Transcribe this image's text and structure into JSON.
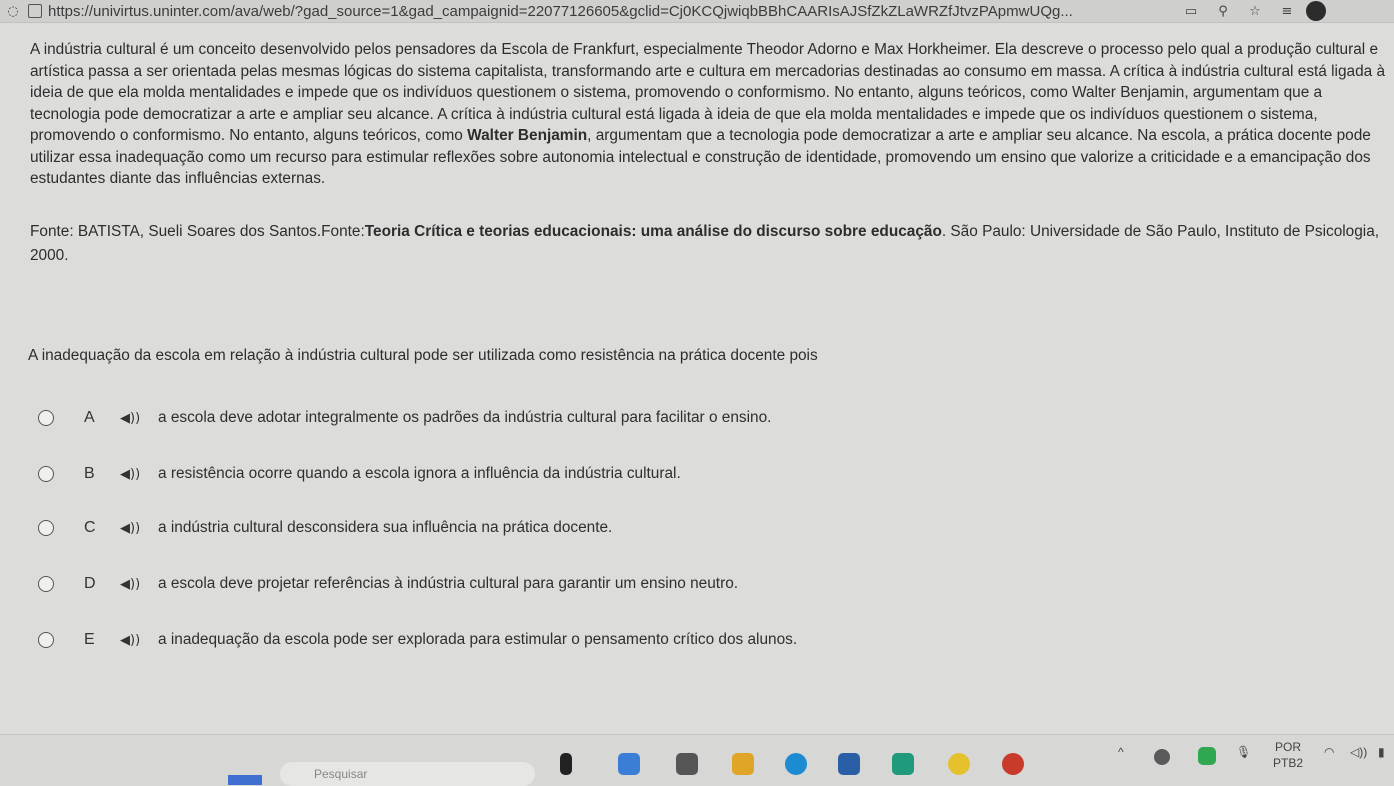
{
  "browser": {
    "url": "https://univirtus.uninter.com/ava/web/?gad_source=1&gad_campaignid=22077126605&gclid=Cj0KCQjwiqbBBhCAARIsAJSfZkZLaWRZfJtvzPApmwUQg..."
  },
  "passage": {
    "text": "A indústria cultural é um conceito desenvolvido pelos pensadores da Escola de Frankfurt, especialmente Theodor Adorno e Max Horkheimer. Ela descreve o processo pelo qual a produção cultural e artística passa a ser orientada pelas mesmas lógicas do sistema capitalista, transformando arte e cultura em mercadorias destinadas ao consumo em massa. A crítica à indústria cultural está ligada à ideia de que ela molda mentalidades e impede que os indivíduos questionem o sistema, promovendo o conformismo. No entanto, alguns teóricos, como Walter Benjamin, argumentam que a tecnologia pode democratizar a arte e ampliar seu alcance. A crítica à indústria cultural está ligada à ideia de que ela molda mentalidades e impede que os indivíduos questionem o sistema, promovendo o conformismo. No entanto, alguns teóricos, como",
    "bold_name": "Walter Benjamin",
    "text_after": ", argumentam que a tecnologia pode democratizar a arte e ampliar seu alcance. Na escola, a prática docente pode utilizar essa inadequação como um recurso para estimular reflexões sobre autonomia intelectual e construção de identidade, promovendo um ensino que valorize a criticidade e a emancipação dos estudantes diante das influências externas."
  },
  "source": {
    "prefix": "Fonte: BATISTA, Sueli Soares dos Santos.Fonte:",
    "title": "Teoria Crítica e teorias educacionais: uma análise do discurso sobre educação",
    "suffix": ". São Paulo: Universidade de São Paulo, Instituto de Psicologia, 2000."
  },
  "question": "A inadequação da escola em relação à indústria cultural pode ser utilizada como resistência na prática docente pois",
  "options": [
    {
      "letter": "A",
      "text": "a escola deve adotar integralmente os padrões da indústria cultural para facilitar o ensino.",
      "selected": false
    },
    {
      "letter": "B",
      "text": "a resistência ocorre quando a escola ignora a influência da indústria cultural.",
      "selected": false
    },
    {
      "letter": "C",
      "text": "a indústria cultural desconsidera sua influência na prática docente.",
      "selected": false
    },
    {
      "letter": "D",
      "text": "a escola deve projetar referências à indústria cultural para garantir um ensino neutro.",
      "selected": false
    },
    {
      "letter": "E",
      "text": "a inadequação da escola pode ser explorada para estimular o pensamento crítico dos alunos.",
      "selected": false
    }
  ],
  "taskbar": {
    "search_placeholder": "Pesquisar",
    "language_line1": "POR",
    "language_line2": "PTB2"
  },
  "icons": {
    "back": "back-icon",
    "page": "page-icon",
    "reader": "reader-mode-icon",
    "zoom": "zoom-icon",
    "favorite": "star-icon",
    "favorites_list": "favorites-icon",
    "speaker": "speaker-icon"
  }
}
